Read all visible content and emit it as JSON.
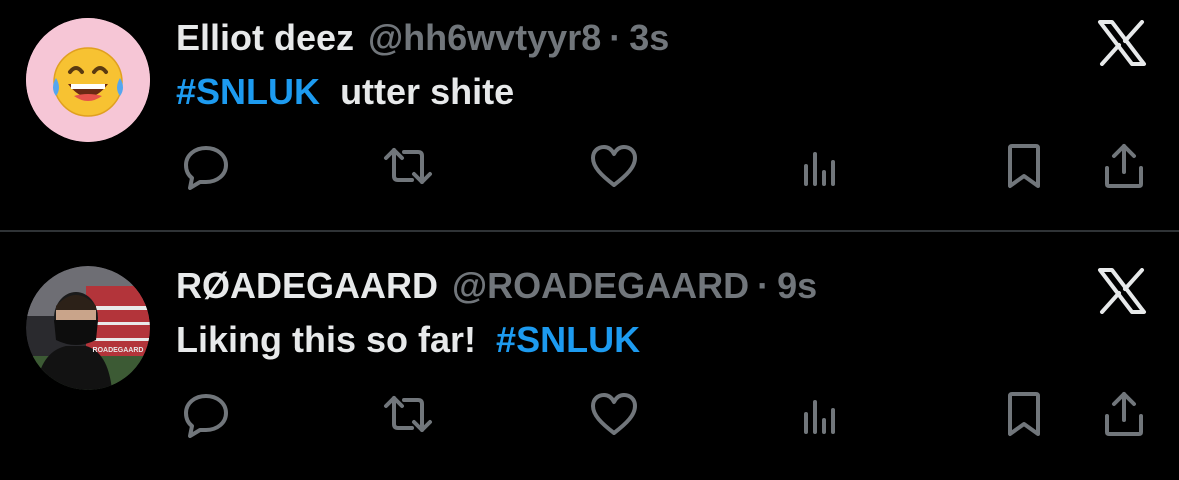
{
  "tweets": [
    {
      "avatar_icon": "laughing-face-emoji-icon",
      "avatar_bg": "#f6c6d6",
      "name": "Elliot deez",
      "handle": "@hh6wvtyyr8",
      "separator": "·",
      "time": "3s",
      "hashtag": "#SNLUK",
      "text": "utter shite",
      "actions": [
        "reply-icon",
        "retweet-icon",
        "like-icon",
        "views-icon",
        "bookmark-icon",
        "share-icon"
      ]
    },
    {
      "avatar_icon": "masked-person-photo",
      "avatar_watermark": "ROADEGAARD",
      "name": "RØADEGAARD",
      "handle": "@ROADEGAARD",
      "separator": "·",
      "time": "9s",
      "text": "Liking this so far! ",
      "hashtag": "#SNLUK",
      "actions": [
        "reply-icon",
        "retweet-icon",
        "like-icon",
        "views-icon",
        "bookmark-icon",
        "share-icon"
      ]
    }
  ],
  "colors": {
    "background": "#000000",
    "primary_text": "#e7e9ea",
    "secondary_text": "#71767b",
    "hashtag": "#1d9bf0",
    "divider": "#2f3336"
  }
}
